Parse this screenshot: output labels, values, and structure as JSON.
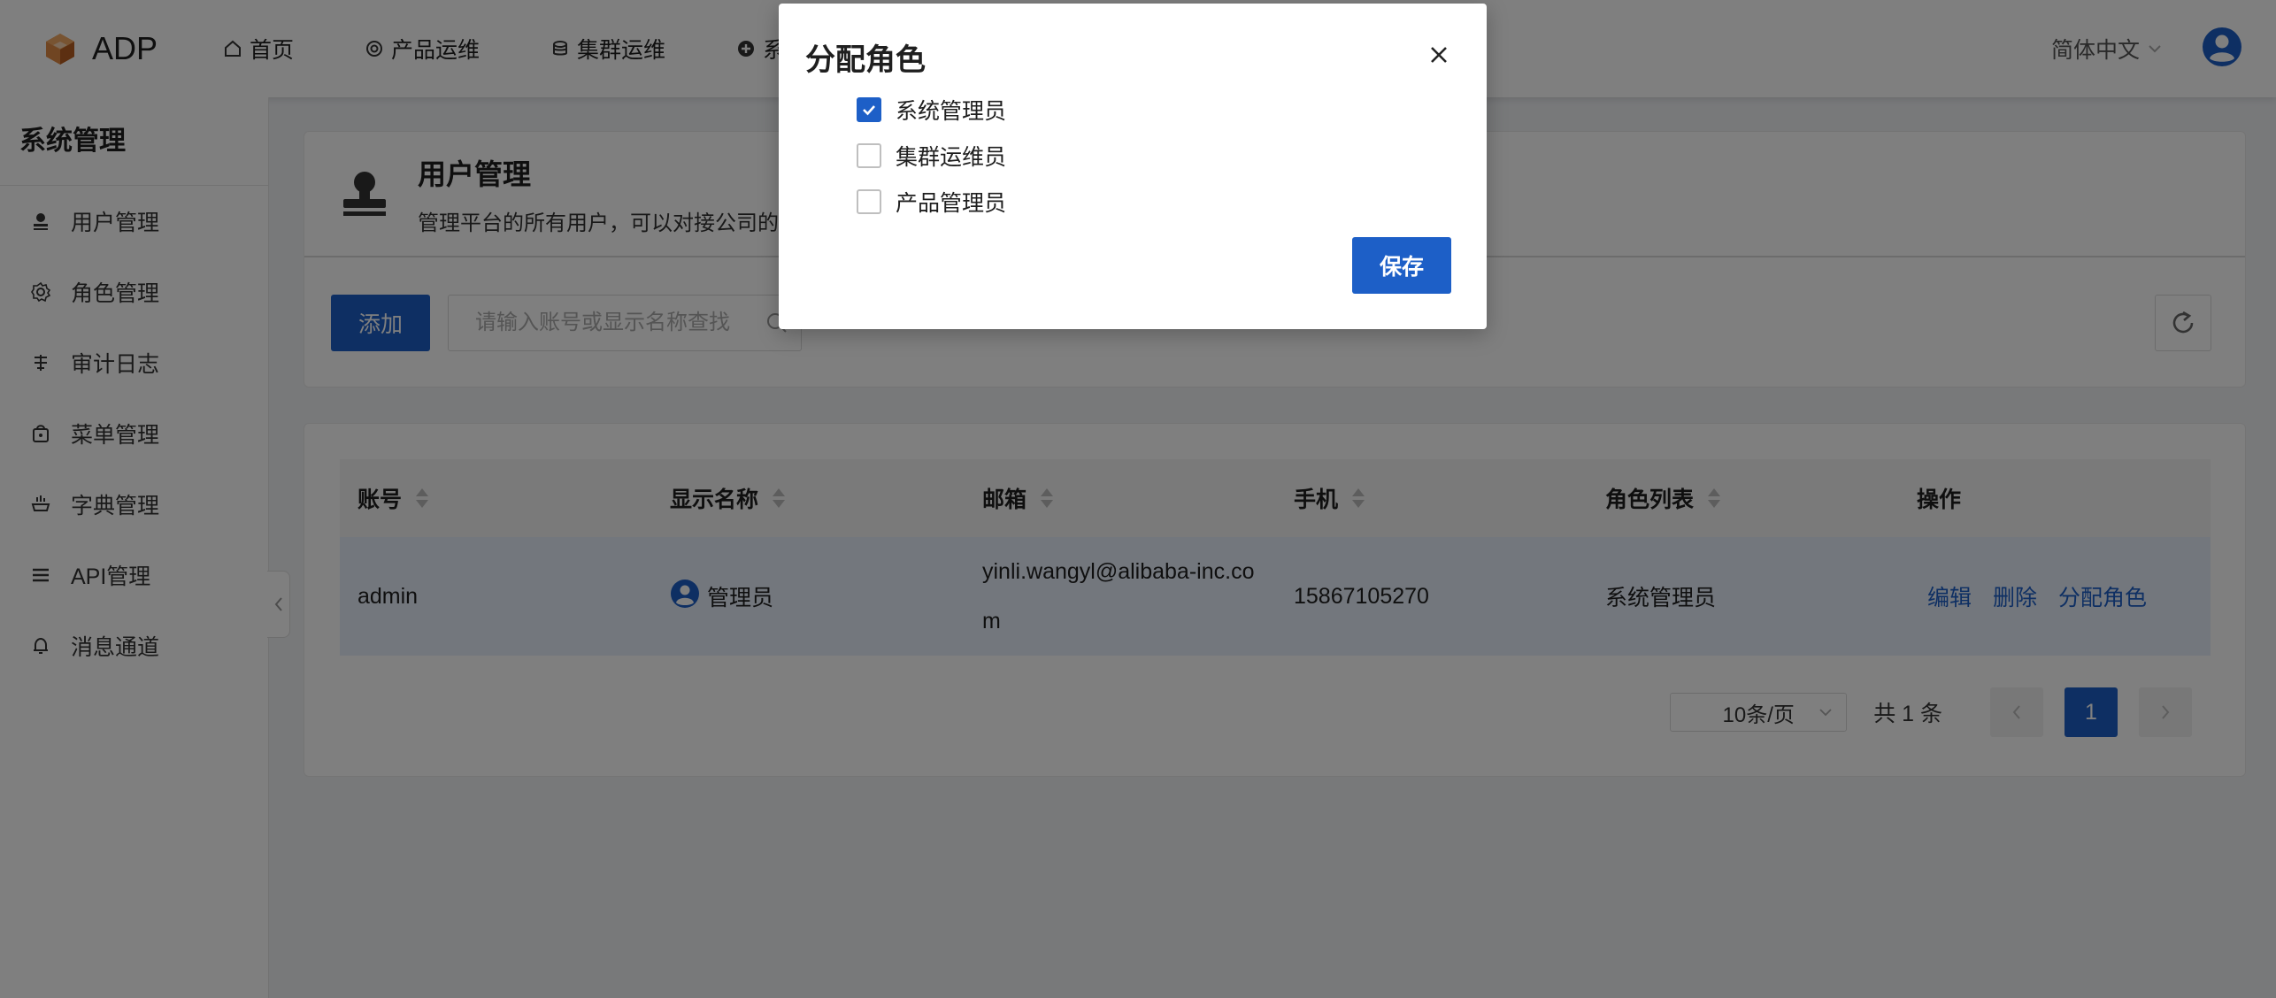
{
  "topbar": {
    "brand": "ADP",
    "nav": [
      {
        "label": "首页",
        "icon": "home-icon"
      },
      {
        "label": "产品运维",
        "icon": "product-ops-icon"
      },
      {
        "label": "集群运维",
        "icon": "cluster-ops-icon"
      },
      {
        "label": "系",
        "icon": "system-icon"
      }
    ],
    "language": "简体中文"
  },
  "sidebar": {
    "title": "系统管理",
    "items": [
      {
        "label": "用户管理",
        "icon": "user-icon"
      },
      {
        "label": "角色管理",
        "icon": "gear-icon"
      },
      {
        "label": "审计日志",
        "icon": "audit-log-icon"
      },
      {
        "label": "菜单管理",
        "icon": "menu-bag-icon"
      },
      {
        "label": "字典管理",
        "icon": "dictionary-icon"
      },
      {
        "label": "API管理",
        "icon": "api-list-icon"
      },
      {
        "label": "消息通道",
        "icon": "bell-icon"
      }
    ]
  },
  "header": {
    "title": "用户管理",
    "description": "管理平台的所有用户，可以对接公司的"
  },
  "toolbar": {
    "add_label": "添加",
    "search_placeholder": "请输入账号或显示名称查找"
  },
  "table": {
    "columns": [
      "账号",
      "显示名称",
      "邮箱",
      "手机",
      "角色列表",
      "操作"
    ],
    "rows": [
      {
        "account": "admin",
        "display_name": "管理员",
        "email": "yinli.wangyl@alibaba-inc.com",
        "phone": "15867105270",
        "roles": "系统管理员",
        "actions": [
          "编辑",
          "删除",
          "分配角色"
        ]
      }
    ]
  },
  "pagination": {
    "page_size": "10条/页",
    "total": "共 1 条",
    "current_page": "1"
  },
  "modal": {
    "title": "分配角色",
    "roles": [
      {
        "label": "系统管理员",
        "checked": true
      },
      {
        "label": "集群运维员",
        "checked": false
      },
      {
        "label": "产品管理员",
        "checked": false
      }
    ],
    "save_label": "保存"
  },
  "colors": {
    "primary": "#1d5fc7",
    "row_highlight": "#e6eefb",
    "logo": "#c86a2b"
  }
}
